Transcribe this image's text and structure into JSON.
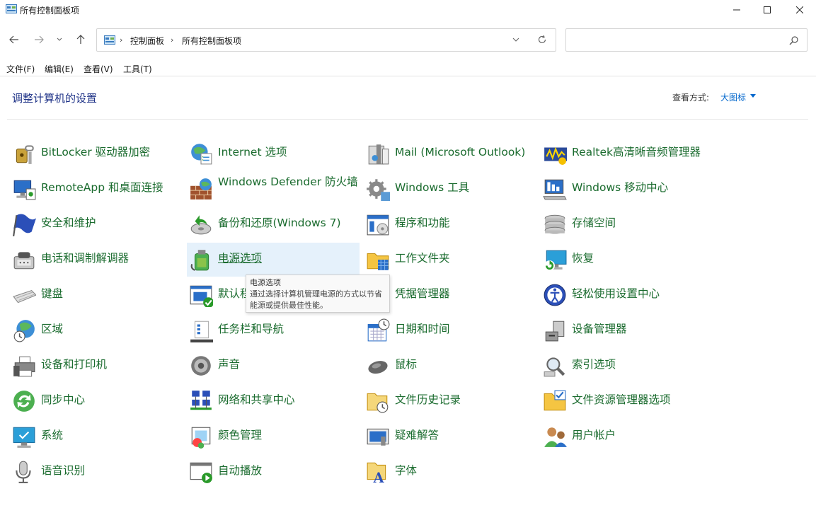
{
  "window": {
    "title": "所有控制面板项",
    "controls": {
      "minimize": "minimize",
      "maximize": "maximize",
      "close": "close"
    }
  },
  "address": {
    "crumbs": [
      "控制面板",
      "所有控制面板项"
    ],
    "search_placeholder": ""
  },
  "menu": [
    "文件(F)",
    "编辑(E)",
    "查看(V)",
    "工具(T)"
  ],
  "header": {
    "title": "调整计算机的设置",
    "view_by_label": "查看方式:",
    "view_by_value": "大图标"
  },
  "items": [
    {
      "label": "BitLocker 驱动器加密",
      "icon": "bitlocker-icon"
    },
    {
      "label": "Internet 选项",
      "icon": "internet-options-icon"
    },
    {
      "label": "Mail (Microsoft Outlook)",
      "icon": "mail-icon"
    },
    {
      "label": "Realtek高清晰音频管理器",
      "icon": "realtek-audio-icon"
    },
    {
      "label": "RemoteApp 和桌面连接",
      "icon": "remoteapp-icon"
    },
    {
      "label": "Windows Defender 防火墙",
      "icon": "firewall-icon"
    },
    {
      "label": "Windows 工具",
      "icon": "windows-tools-icon"
    },
    {
      "label": "Windows 移动中心",
      "icon": "mobility-center-icon"
    },
    {
      "label": "安全和维护",
      "icon": "security-flag-icon"
    },
    {
      "label": "备份和还原(Windows 7)",
      "icon": "backup-restore-icon"
    },
    {
      "label": "程序和功能",
      "icon": "programs-features-icon"
    },
    {
      "label": "存储空间",
      "icon": "storage-spaces-icon"
    },
    {
      "label": "电话和调制解调器",
      "icon": "phone-modem-icon"
    },
    {
      "label": "电源选项",
      "icon": "power-options-icon"
    },
    {
      "label": "工作文件夹",
      "icon": "work-folders-icon"
    },
    {
      "label": "恢复",
      "icon": "recovery-icon"
    },
    {
      "label": "键盘",
      "icon": "keyboard-icon"
    },
    {
      "label": "默认程序",
      "icon": "default-programs-icon"
    },
    {
      "label": "凭据管理器",
      "icon": "credential-manager-icon"
    },
    {
      "label": "轻松使用设置中心",
      "icon": "ease-of-access-icon"
    },
    {
      "label": "区域",
      "icon": "region-icon"
    },
    {
      "label": "任务栏和导航",
      "icon": "taskbar-icon"
    },
    {
      "label": "日期和时间",
      "icon": "date-time-icon"
    },
    {
      "label": "设备管理器",
      "icon": "device-manager-icon"
    },
    {
      "label": "设备和打印机",
      "icon": "devices-printers-icon"
    },
    {
      "label": "声音",
      "icon": "sound-icon"
    },
    {
      "label": "鼠标",
      "icon": "mouse-icon"
    },
    {
      "label": "索引选项",
      "icon": "indexing-icon"
    },
    {
      "label": "同步中心",
      "icon": "sync-center-icon"
    },
    {
      "label": "网络和共享中心",
      "icon": "network-icon"
    },
    {
      "label": "文件历史记录",
      "icon": "file-history-icon"
    },
    {
      "label": "文件资源管理器选项",
      "icon": "explorer-options-icon"
    },
    {
      "label": "系统",
      "icon": "system-icon"
    },
    {
      "label": "颜色管理",
      "icon": "color-management-icon"
    },
    {
      "label": "疑难解答",
      "icon": "troubleshooting-icon"
    },
    {
      "label": "用户帐户",
      "icon": "user-accounts-icon"
    },
    {
      "label": "语音识别",
      "icon": "speech-icon"
    },
    {
      "label": "自动播放",
      "icon": "autoplay-icon"
    },
    {
      "label": "字体",
      "icon": "fonts-icon"
    }
  ],
  "hovered_item": "电源选项",
  "tooltip": {
    "title": "电源选项",
    "description": "通过选择计算机管理电源的方式以节省能源或提供最佳性能。"
  },
  "colors": {
    "item_label": "#1a6b2e",
    "header_title": "#1e3287",
    "link": "#0066cc",
    "hover_bg": "#e5f1fb"
  }
}
